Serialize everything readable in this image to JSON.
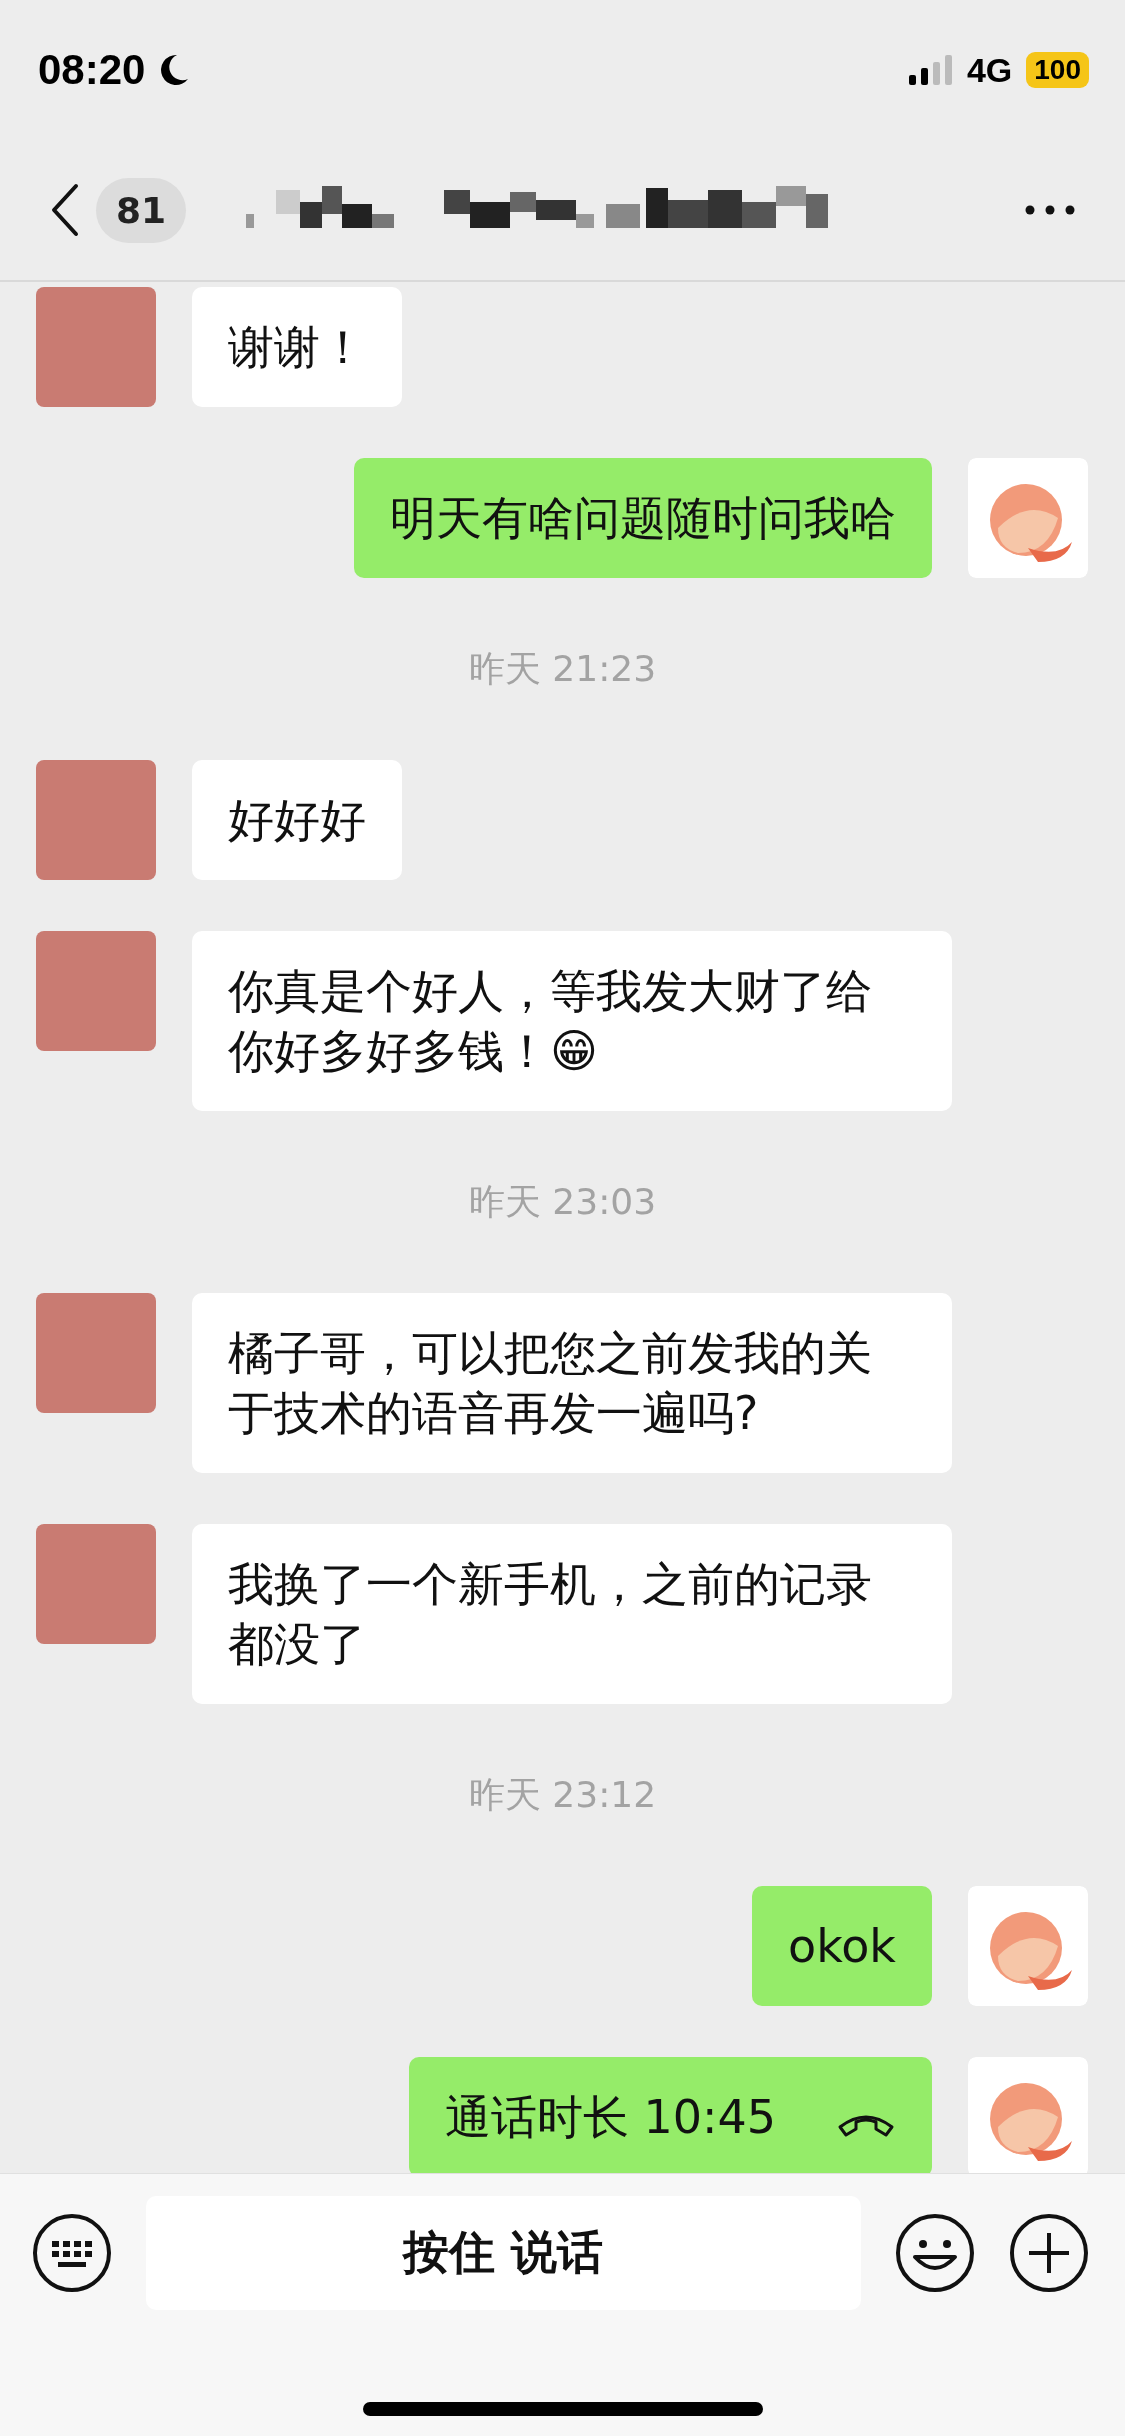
{
  "status_bar": {
    "time": "08:20",
    "network": "4G",
    "battery": "100"
  },
  "nav": {
    "unread_count": "81"
  },
  "messages": [
    {
      "kind": "text",
      "outgoing": false,
      "text": "谢谢！"
    },
    {
      "kind": "text",
      "outgoing": true,
      "text": "明天有啥问题随时问我哈"
    },
    {
      "kind": "time",
      "text": "昨天 21:23"
    },
    {
      "kind": "text",
      "outgoing": false,
      "text": "好好好"
    },
    {
      "kind": "text",
      "outgoing": false,
      "text": "你真是个好人，等我发大财了给你好多好多钱！😁"
    },
    {
      "kind": "time",
      "text": "昨天 23:03"
    },
    {
      "kind": "text",
      "outgoing": false,
      "text": "橘子哥，可以把您之前发我的关于技术的语音再发一遍吗?"
    },
    {
      "kind": "text",
      "outgoing": false,
      "text": "我换了一个新手机，之前的记录都没了"
    },
    {
      "kind": "time",
      "text": "昨天 23:12"
    },
    {
      "kind": "text",
      "outgoing": true,
      "text": "okok"
    },
    {
      "kind": "call",
      "outgoing": true,
      "text": "通话时长 10:45"
    }
  ],
  "input_bar": {
    "hold_to_talk": "按住 说话"
  }
}
